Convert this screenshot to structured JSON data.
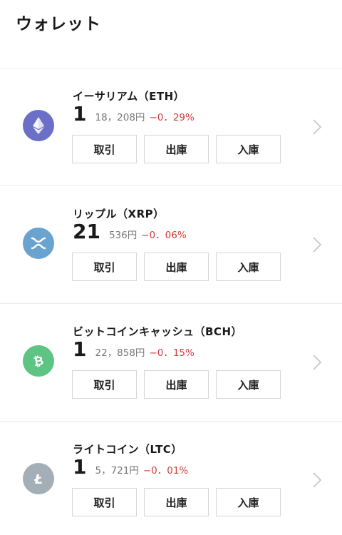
{
  "header": {
    "title": "ウォレット"
  },
  "coins": [
    {
      "name": "イーサリアム（ETH）",
      "amount": "1",
      "price": "18，208円",
      "change": "−0．29%",
      "icon": "ethereum-icon",
      "color": "#6B6FC8",
      "buttons": {
        "trade": "取引",
        "withdraw": "出庫",
        "deposit": "入庫"
      }
    },
    {
      "name": "リップル（XRP）",
      "amount": "21",
      "price": "536円",
      "change": "−0．06%",
      "icon": "ripple-icon",
      "color": "#6AA3CF",
      "buttons": {
        "trade": "取引",
        "withdraw": "出庫",
        "deposit": "入庫"
      }
    },
    {
      "name": "ビットコインキャッシュ（BCH）",
      "amount": "1",
      "price": "22，858円",
      "change": "−0．15%",
      "icon": "bitcoin-cash-icon",
      "color": "#5DC483",
      "buttons": {
        "trade": "取引",
        "withdraw": "出庫",
        "deposit": "入庫"
      }
    },
    {
      "name": "ライトコイン（LTC）",
      "amount": "1",
      "price": "5，721円",
      "change": "−0．01%",
      "icon": "litecoin-icon",
      "color": "#A4AEB6",
      "buttons": {
        "trade": "取引",
        "withdraw": "出庫",
        "deposit": "入庫"
      }
    }
  ],
  "colors": {
    "negative": "#d23c3c",
    "border": "#ececec"
  }
}
